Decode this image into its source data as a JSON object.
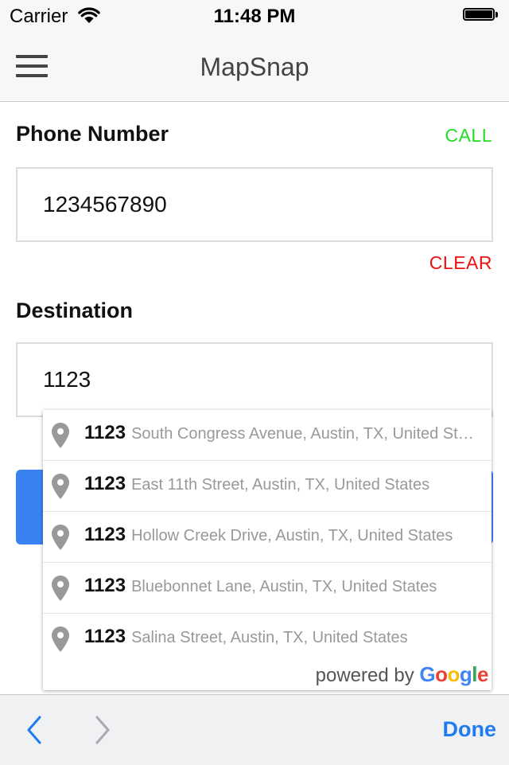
{
  "status_bar": {
    "carrier": "Carrier",
    "time": "11:48 PM"
  },
  "nav_bar": {
    "title": "MapSnap"
  },
  "phone": {
    "label": "Phone Number",
    "action_label": "CALL",
    "value": "1234567890",
    "clear_label": "CLEAR"
  },
  "destination": {
    "label": "Destination",
    "value": "1123"
  },
  "suggestions": [
    {
      "number": "1123",
      "address": "South Congress Avenue, Austin, TX, United States"
    },
    {
      "number": "1123",
      "address": "East 11th Street, Austin, TX, United States"
    },
    {
      "number": "1123",
      "address": "Hollow Creek Drive, Austin, TX, United States"
    },
    {
      "number": "1123",
      "address": "Bluebonnet Lane, Austin, TX, United States"
    },
    {
      "number": "1123",
      "address": "Salina Street, Austin, TX, United States"
    }
  ],
  "attribution": {
    "prefix": "powered by",
    "brand_letters": [
      "G",
      "o",
      "o",
      "g",
      "l",
      "e"
    ]
  },
  "toolbar": {
    "done_label": "Done"
  },
  "colors": {
    "call": "#22dd22",
    "clear": "#ee1111",
    "primary_button": "#3a82f0",
    "done": "#1f7cf0",
    "google": [
      "#4285F4",
      "#EA4335",
      "#FBBC05",
      "#4285F4",
      "#34A853",
      "#EA4335"
    ]
  },
  "icons": {
    "menu": "hamburger-icon",
    "wifi": "wifi-icon",
    "battery": "battery-icon",
    "pin": "map-pin-icon",
    "prev": "chevron-left-icon",
    "next": "chevron-right-icon"
  }
}
